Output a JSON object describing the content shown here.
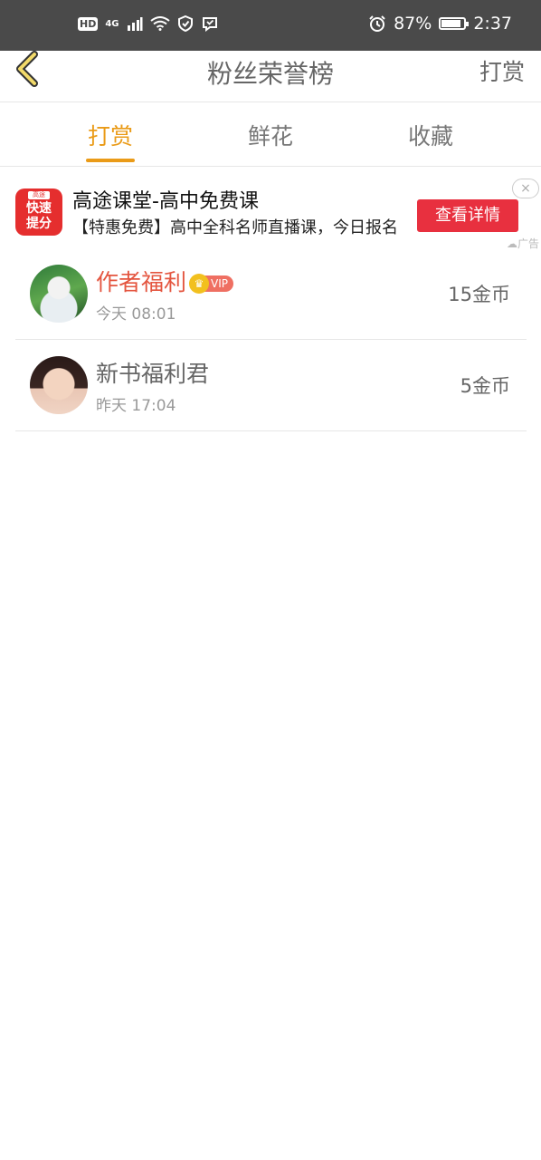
{
  "status_bar": {
    "hd": "HD",
    "network": "4G",
    "battery_text": "87%",
    "battery_level": 0.87,
    "time": "2:37",
    "icons": [
      "wifi-icon",
      "shield-icon",
      "message-icon",
      "alarm-icon"
    ]
  },
  "nav": {
    "title": "粉丝荣誉榜",
    "action": "打赏",
    "back_icon": "chevron-left-icon"
  },
  "tabs": [
    {
      "label": "打赏",
      "active": true
    },
    {
      "label": "鲜花",
      "active": false
    },
    {
      "label": "收藏",
      "active": false
    }
  ],
  "ad": {
    "logo_small": "高途",
    "logo_big": "快速提分",
    "title": "高途课堂-高中免费课",
    "desc": "【特惠免费】高中全科名师直播课，今日报名",
    "button": "查看详情",
    "close": "×",
    "tag": "广告"
  },
  "rows": [
    {
      "name": "作者福利",
      "vip": "VIP",
      "time": "今天 08:01",
      "coins": "15金币"
    },
    {
      "name": "新书福利君",
      "time": "昨天 17:04",
      "coins": "5金币"
    }
  ],
  "colors": {
    "accent": "#ea9b18",
    "ad_button": "#e8303f",
    "highlight_name": "#e4553f"
  }
}
